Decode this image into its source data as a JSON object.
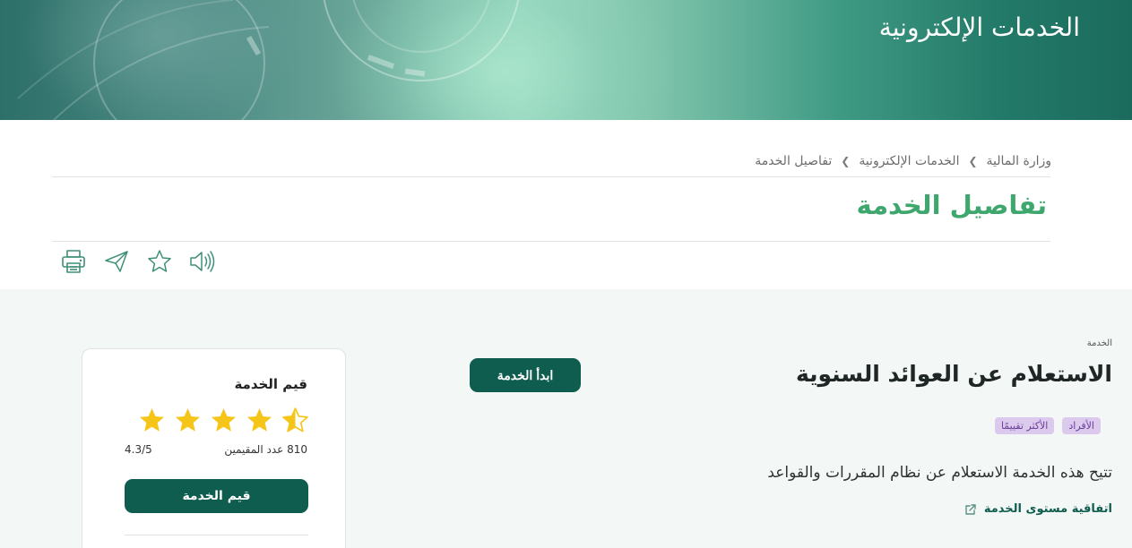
{
  "banner": {
    "title": "الخدمات الإلكترونية"
  },
  "breadcrumb": [
    {
      "label": "وزارة المالية"
    },
    {
      "label": "الخدمات الإلكترونية"
    },
    {
      "label": "تفاصيل الخدمة"
    }
  ],
  "page": {
    "title": "تفاصيل الخدمة"
  },
  "tools": [
    {
      "name": "speaker-icon"
    },
    {
      "name": "star-outline-icon"
    },
    {
      "name": "send-icon"
    },
    {
      "name": "print-icon"
    }
  ],
  "service": {
    "label": "الخدمة",
    "title": "الاستعلام عن العوائد السنوية",
    "start_button": "ابدأ الخدمة",
    "badges": [
      "الأفراد",
      "الأكثر تقييمًا"
    ],
    "description": "تتيح هذه الخدمة الاستعلام عن نظام المقررات والقواعد",
    "sla_link": "اتفاقية مستوى الخدمة"
  },
  "rating": {
    "title": "قيم الخدمة",
    "stars_value": 4.3,
    "stars_max": 5,
    "raters_text": "810 عدد المقيمين",
    "average_text": "4.3/5",
    "button": "قيم الخدمة"
  },
  "colors": {
    "primary": "#0f5d4f",
    "title_green": "#3ea76d",
    "badge_bg": "#dcc9ee",
    "badge_text": "#6a3e98",
    "star": "#f5c518"
  }
}
